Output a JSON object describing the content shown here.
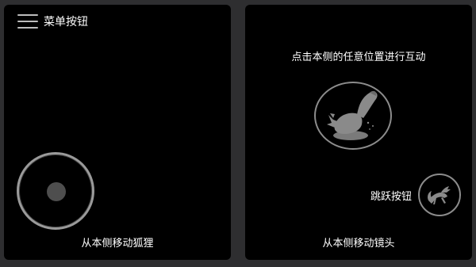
{
  "menu": {
    "label": "菜单按钮",
    "icon": "hamburger-menu-icon"
  },
  "left_panel": {
    "caption": "从本侧移动狐狸"
  },
  "right_panel": {
    "hint": "点击本侧的任意位置进行互动",
    "caption": "从本侧移动镜头",
    "interact_icon": "fox-icon",
    "jump": {
      "label": "跳跃按钮",
      "icon": "jumping-fox-icon"
    }
  },
  "colors": {
    "background": "#2e2e30",
    "panel": "#000000",
    "ring": "#8c8c8c",
    "fox": "#8a8a8a"
  }
}
